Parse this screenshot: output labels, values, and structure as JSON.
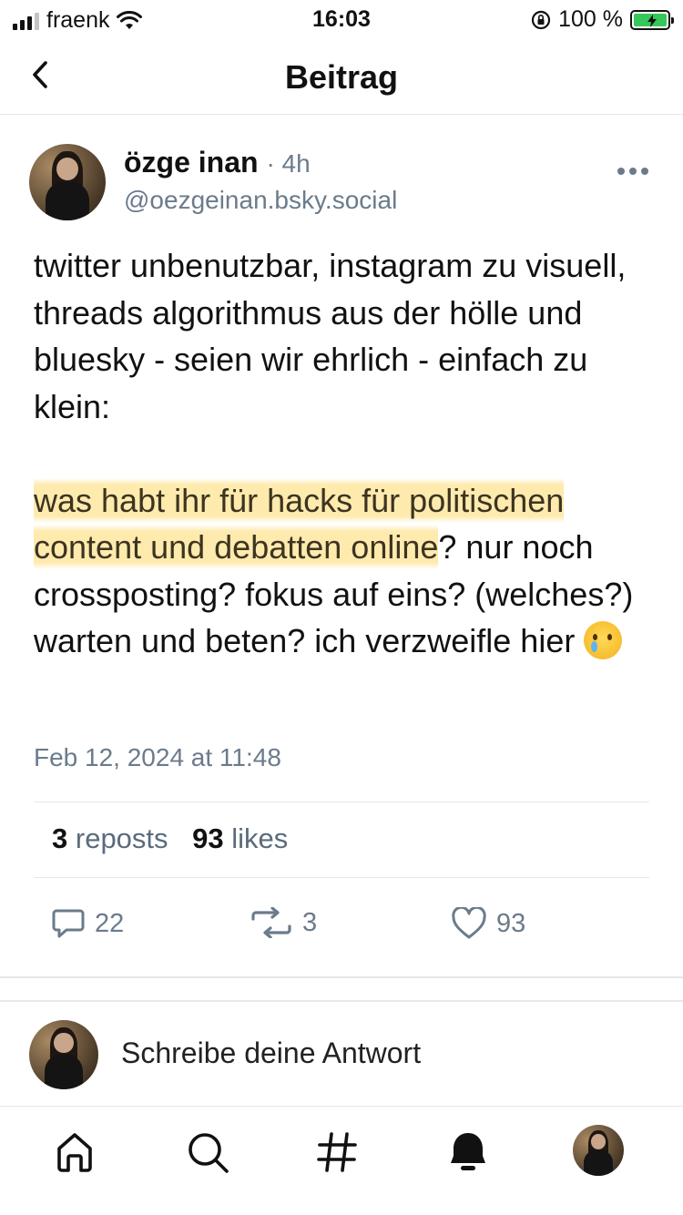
{
  "status_bar": {
    "carrier": "fraenk",
    "time": "16:03",
    "battery_percent": "100 %",
    "battery_level": 1.0
  },
  "header": {
    "title": "Beitrag",
    "back_icon": "chevron-left-icon"
  },
  "post": {
    "author_name": "özge inan",
    "age": "· 4h",
    "handle": "@oezgeinan.bsky.social",
    "text_paragraph_1": "twitter unbenutzbar, instagram zu visuell, threads algorithmus aus der hölle und bluesky - seien wir ehrlich - einfach zu klein:",
    "text_highlighted": "was habt ihr für hacks für politischen content und debatten online",
    "text_rest": "? nur noch crossposting? fokus auf eins? (welches?) warten und beten? ich verzweifle hier ",
    "emoji": "crying-face-emoji",
    "date": "Feb 12, 2024 at 11:48",
    "reposts_count": "3",
    "reposts_label": "reposts",
    "likes_count": "93",
    "likes_label": "likes",
    "actions": {
      "reply_count": "22",
      "repost_count": "3",
      "like_count": "93"
    }
  },
  "reply_composer": {
    "placeholder": "Schreibe deine Antwort"
  },
  "tab_bar": {
    "tabs": [
      "home-icon",
      "search-icon",
      "hashtag-icon",
      "notifications-bell-icon",
      "profile-avatar"
    ]
  },
  "colors": {
    "secondary_text": "#6b7b8c",
    "highlight": "#ffe7a0",
    "divider": "#e4e8ed",
    "battery_green": "#35c759"
  }
}
